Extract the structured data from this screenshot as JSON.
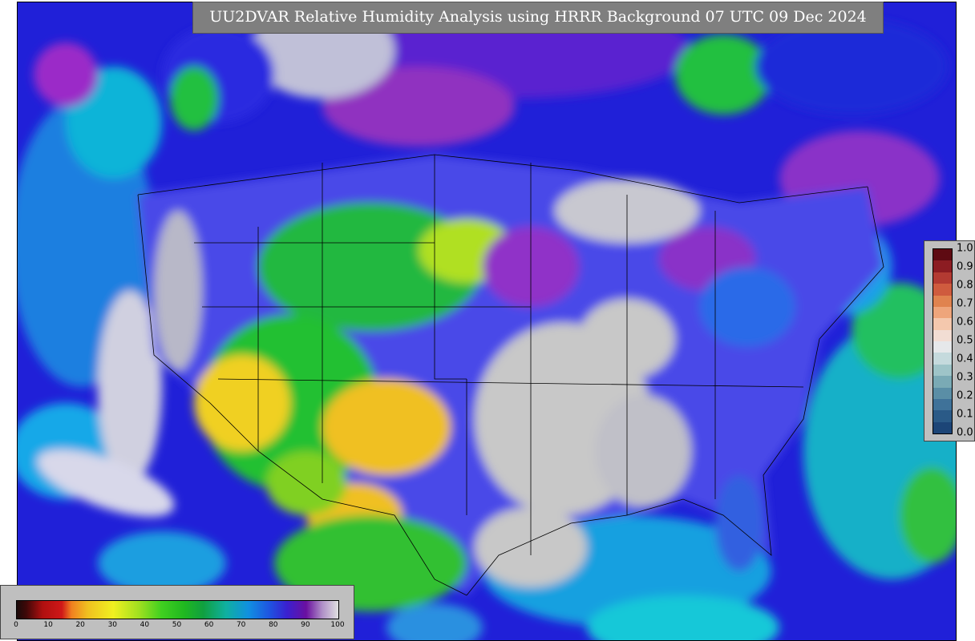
{
  "title": "UU2DVAR Relative Humidity Analysis using HRRR Background 07 UTC 09 Dec 2024",
  "rh_colorbar": {
    "ticks": [
      "0",
      "10",
      "20",
      "30",
      "40",
      "50",
      "60",
      "70",
      "80",
      "90",
      "100"
    ],
    "range": [
      0,
      100
    ]
  },
  "ratio_colorbar": {
    "ticks": [
      "1.0",
      "0.9",
      "0.8",
      "0.7",
      "0.6",
      "0.5",
      "0.4",
      "0.3",
      "0.2",
      "0.1",
      "0.0"
    ],
    "colors": [
      "#5e0a12",
      "#8c1c22",
      "#b33a32",
      "#cf5b3e",
      "#e0834f",
      "#eea57b",
      "#f4c8ad",
      "#f2ddd3",
      "#e6e8ea",
      "#c5dadd",
      "#9ec4c8",
      "#7aaab5",
      "#5a8ea6",
      "#3f7299",
      "#2a5a87",
      "#1c4577"
    ]
  }
}
